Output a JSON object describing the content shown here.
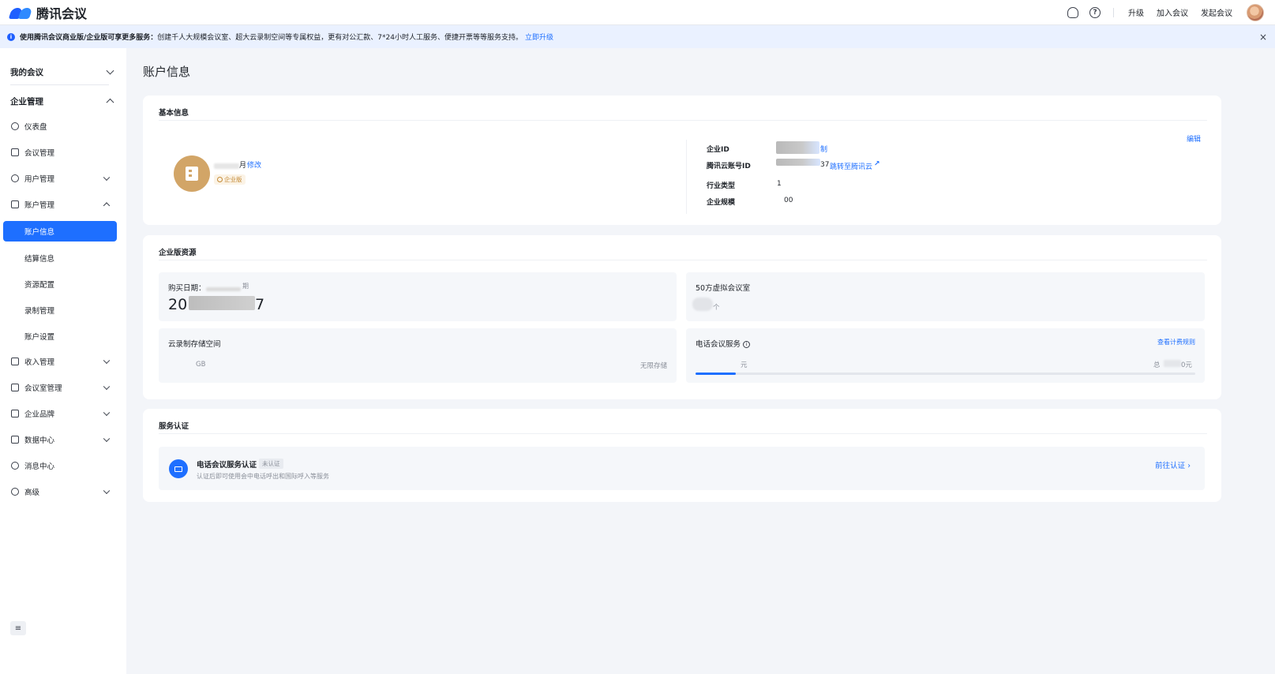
{
  "header": {
    "app_name": "腾讯会议",
    "support_icon": "headset-icon",
    "help_icon": "help-icon",
    "help_glyph": "?",
    "links": [
      "升级",
      "加入会议",
      "发起会议"
    ]
  },
  "notice": {
    "prefix": "使用腾讯会议商业版/企业版可享更多服务：",
    "text": "创建千人大规模会议室、超大云录制空间等专属权益，更有对公汇款、7*24小时人工服务、便捷开票等等服务支持。",
    "link": "立即升级",
    "close": "×"
  },
  "sidebar": {
    "my_meetings": "我的会议",
    "enterprise": "企业管理",
    "items": {
      "dashboard": "仪表盘",
      "meeting_mgmt": "会议管理",
      "user_mgmt": "用户管理",
      "account_mgmt": "账户管理",
      "income_mgmt": "收入管理",
      "room_mgmt": "会议室管理",
      "brand": "企业品牌",
      "data_center": "数据中心",
      "message_center": "消息中心",
      "advanced": "高级"
    },
    "sub_items": {
      "account_info": "账户信息",
      "billing": "结算信息",
      "resources": "资源配置",
      "recording": "录制管理",
      "account_settings": "账户设置"
    },
    "collapse_icon": "≡"
  },
  "page": {
    "title": "账户信息"
  },
  "basic": {
    "title": "基本信息",
    "org_suffix": "月",
    "edit_name": "修改",
    "edition_badge": "企业版",
    "edit": "编辑",
    "labels": {
      "enterprise_id": "企业ID",
      "cloud_id": "腾讯云账号ID",
      "industry": "行业类型",
      "scale": "企业规模"
    },
    "values": {
      "copy": "制",
      "cloud_suffix": "37",
      "jump": "跳转至腾讯云",
      "jump_icon": "↗",
      "industry": "1",
      "scale": "00"
    }
  },
  "resources": {
    "title": "企业版资源",
    "purchase_label": "购买日期：",
    "purchase_suffix": "期",
    "purchase_prefix": "20",
    "purchase_end": "7",
    "rooms_label": "50方虚拟会议室",
    "rooms_unit": "个",
    "storage_label": "云录制存储空间",
    "storage_unit": "GB",
    "storage_right": "无限存储",
    "phone_label": "电话会议服务",
    "phone_info_glyph": "i",
    "phone_link": "查看计费规则",
    "phone_unit": "元",
    "phone_total_prefix": "总",
    "phone_total_suffix": "0元",
    "phone_progress": 0.08
  },
  "service": {
    "title": "服务认证",
    "name": "电话会议服务认证",
    "status": "未认证",
    "desc": "认证后即可使用会中电话呼出和国际呼入等服务",
    "go": "前往认证"
  }
}
